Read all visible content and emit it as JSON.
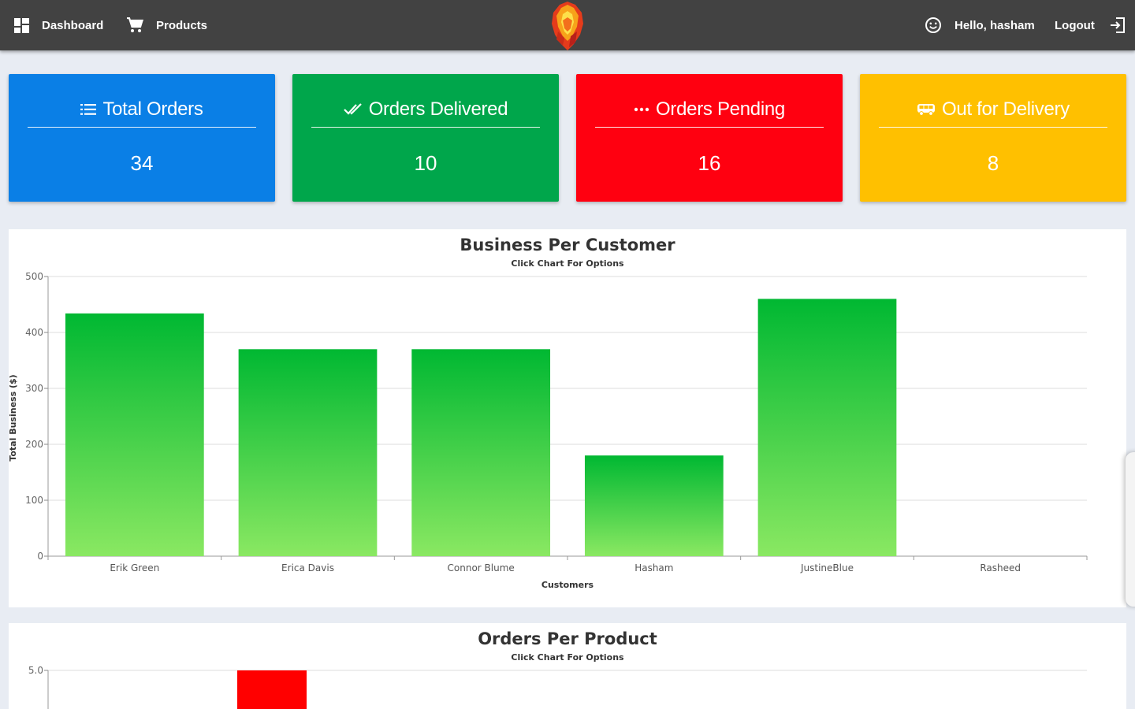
{
  "nav": {
    "dashboard_label": "Dashboard",
    "products_label": "Products",
    "greeting": "Hello, hasham",
    "logout_label": "Logout",
    "icons": {
      "dashboard": "grid-icon",
      "products": "cart-icon",
      "user": "smiley-icon",
      "logout": "logout-icon",
      "logo": "lion-logo"
    }
  },
  "cards": [
    {
      "title": "Total Orders",
      "value": "34",
      "color": "#0a7fe6",
      "icon": "list-icon"
    },
    {
      "title": "Orders Delivered",
      "value": "10",
      "color": "#00a64b",
      "icon": "double-check-icon"
    },
    {
      "title": "Orders Pending",
      "value": "16",
      "color": "#ff0010",
      "icon": "more-horiz-icon"
    },
    {
      "title": "Out for Delivery",
      "value": "8",
      "color": "#ffc000",
      "icon": "bus-icon"
    }
  ],
  "chart_data": [
    {
      "type": "bar",
      "title": "Business Per Customer",
      "subtitle": "Click Chart For Options",
      "xlabel": "Customers",
      "ylabel": "Total Business ($)",
      "ylim": [
        0,
        500
      ],
      "yticks": [
        "0",
        "100",
        "200",
        "300",
        "400",
        "500"
      ],
      "categories": [
        "Erik Green",
        "Erica Davis",
        "Connor Blume",
        "Hasham",
        "JustineBlue",
        "Rasheed"
      ],
      "values": [
        434,
        370,
        370,
        180,
        460,
        0
      ],
      "bar_gradient": [
        "#00b832",
        "#8ae862"
      ],
      "grid": true
    },
    {
      "type": "bar",
      "title": "Orders Per Product",
      "subtitle": "Click Chart For Options",
      "ylim": [
        0,
        5.0
      ],
      "yticks": [
        "5.0"
      ],
      "visible_bars": [
        {
          "slot": 1,
          "value": 5.0,
          "color": "#ff0000"
        }
      ],
      "grid": true
    }
  ]
}
